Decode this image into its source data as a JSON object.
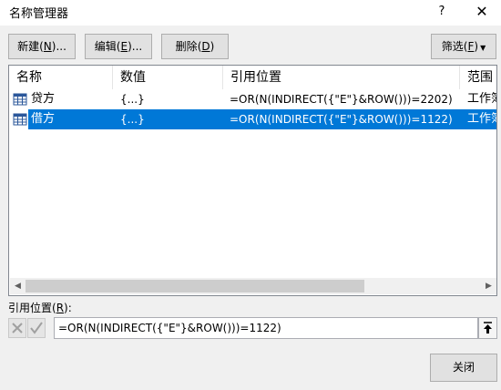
{
  "window": {
    "title": "名称管理器",
    "help_label": "?",
    "close_label": "✕"
  },
  "toolbar": {
    "new_label": "新建",
    "new_key": "N",
    "new_suffix": "...",
    "edit_label": "编辑",
    "edit_key": "E",
    "edit_suffix": "...",
    "delete_label": "删除",
    "delete_key": "D",
    "filter_label": "筛选",
    "filter_key": "F"
  },
  "table": {
    "columns": [
      "名称",
      "数值",
      "引用位置",
      "范围"
    ],
    "rows": [
      {
        "name": "贷方",
        "value": "{...}",
        "refers_to": "=OR(N(INDIRECT({\"E\"}&ROW()))=2202)",
        "scope": "工作簿",
        "selected": false
      },
      {
        "name": "借方",
        "value": "{...}",
        "refers_to": "=OR(N(INDIRECT({\"E\"}&ROW()))=1122)",
        "scope": "工作簿",
        "selected": true
      }
    ]
  },
  "refers_to": {
    "label": "引用位置",
    "key": "R",
    "value": "=OR(N(INDIRECT({\"E\"}&ROW()))=1122)"
  },
  "footer": {
    "close_label": "关闭"
  },
  "colors": {
    "selection": "#0078d7",
    "table_icon": "#2b579a"
  }
}
